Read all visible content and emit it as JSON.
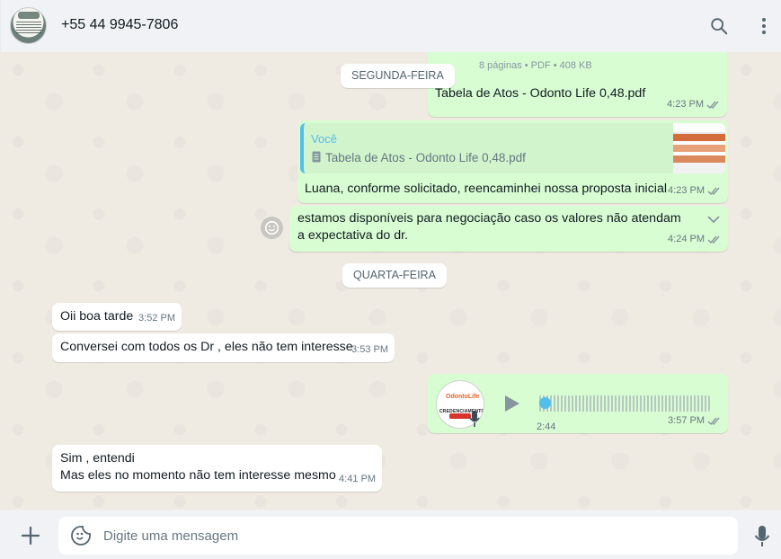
{
  "header": {
    "contact": "+55 44 9945-7806",
    "icons": [
      "search-icon",
      "menu-dots-icon"
    ]
  },
  "dates": {
    "monday": "SEGUNDA-FEIRA",
    "wednesday": "QUARTA-FEIRA"
  },
  "messages": {
    "pdf_info": "8 páginas • PDF • 408 KB",
    "pdf_name": "Tabela de Atos - Odonto Life 0,48.pdf",
    "pdf_time": "4:23 PM",
    "quote_author": "Você",
    "quote_file": "Tabela de Atos - Odonto Life 0,48.pdf",
    "reply_text": "Luana, conforme solicitado, reencaminhei nossa proposta inicial",
    "reply_time": "4:23 PM",
    "nego_text": "estamos disponíveis para negociação caso os valores não atendam a expectativa do dr.",
    "nego_time": "4:24 PM",
    "in1_text": "Oii boa tarde",
    "in1_time": "3:52 PM",
    "in2_text": "Conversei com todos os Dr , eles não tem interesse",
    "in2_time": "3:53 PM",
    "audio_duration": "2:44",
    "audio_time": "3:57 PM",
    "audio_avatar_brand": "OdontoLife",
    "audio_avatar_label": "CREDENCIAMENTO",
    "in3_line1": "Sim , entendi",
    "in3_line2": "Mas eles no momento não tem interesse mesmo",
    "in3_time": "4:41 PM"
  },
  "composer": {
    "placeholder": "Digite uma mensagem"
  },
  "colors": {
    "outgoing": "#d9fdd3",
    "incoming": "#ffffff",
    "accent": "#53bdeb"
  }
}
